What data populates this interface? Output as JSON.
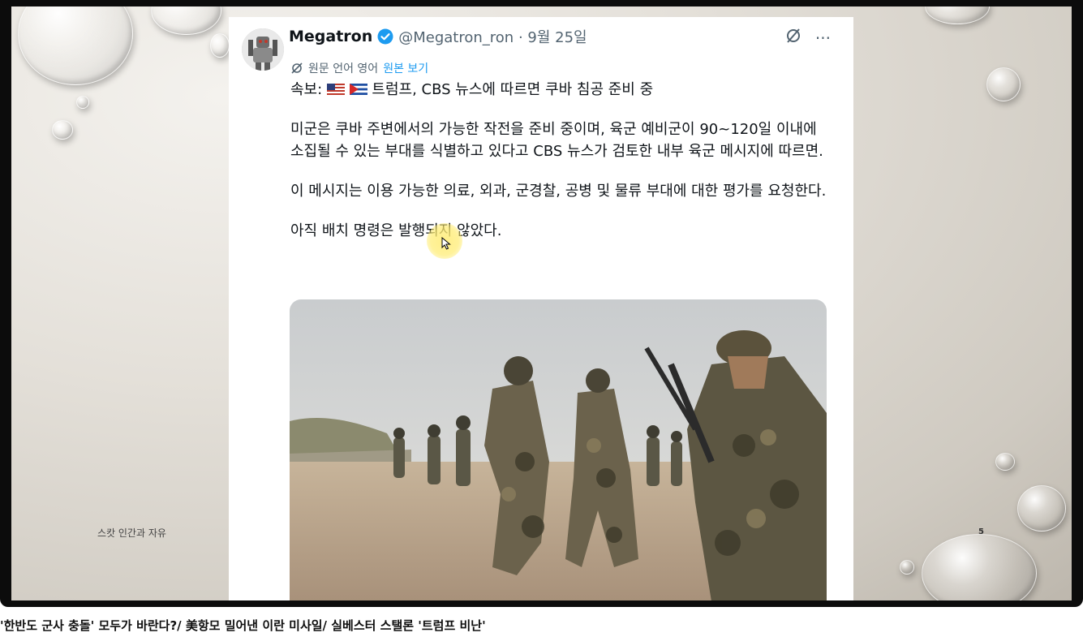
{
  "slide": {
    "footer_text": "스캇 인간과 자유",
    "page_number": "5"
  },
  "tweet": {
    "author_name": "Megatron",
    "handle_date": "@Megatron_ron · 9월 25일",
    "translate_label": "원문 언어 영어",
    "show_original_label": "원본 보기",
    "headline_prefix": "속보:",
    "headline_text": "트럼프, CBS 뉴스에 따르면 쿠바 침공 준비 중",
    "paragraph_1": "미군은 쿠바 주변에서의 가능한 작전을 준비 중이며, 육군 예비군이 90~120일 이내에 소집될 수 있는 부대를 식별하고 있다고 CBS 뉴스가 검토한 내부 육군 메시지에 따르면.",
    "paragraph_2": "이 메시지는 이용 가능한 의료, 외과, 군경찰, 공병 및 물류 부대에 대한 평가를 요청한다.",
    "paragraph_3": "아직 배치 명령은 발행되지 않았다.",
    "more_icon": "more-icon",
    "translate_icon": "translate-icon",
    "verified_icon": "verified-badge-icon"
  },
  "video_caption": "'한반도 군사 충돌' 모두가 바란다?/ 美항모 밀어낸 이란 미사일/ 실베스터 스탤론 '트럼프 비난'",
  "colors": {
    "link_blue": "#1d9bf0",
    "text_primary": "#0f1419",
    "text_secondary": "#536471"
  }
}
